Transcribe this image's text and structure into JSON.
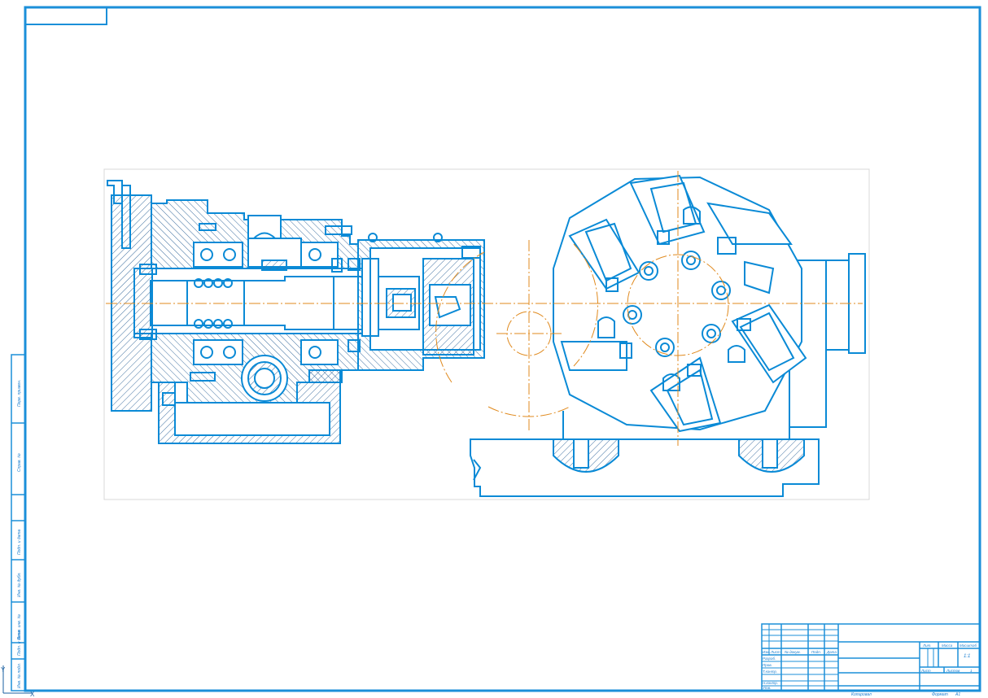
{
  "colors": {
    "line": "#0a8ad6",
    "hatch": "#3d6fa0",
    "center": "#e08a1e",
    "frame": "#1b8fd9"
  },
  "side_strip": {
    "labels": [
      "Перв. примен.",
      "Справ. №",
      "Подп. и дата",
      "Инв. № дубл.",
      "Взам. инв. №",
      "Подп. и дата",
      "Инв. № подл."
    ]
  },
  "title_block": {
    "col_heads": [
      "Изм.",
      "Лист",
      "№ докум.",
      "Подп.",
      "Дата"
    ],
    "row_labels": [
      "Разраб.",
      "Пров.",
      "Т.контр.",
      "Н.контр.",
      "Утв."
    ],
    "lit_heads": [
      "Лит.",
      "Масса",
      "Масштаб"
    ],
    "scale": "1:1",
    "sheet_label": "Лист",
    "sheets_label": "Листов",
    "sheets_value": "1",
    "copied": "Копировал",
    "format": "Формат",
    "format_value": "A1"
  },
  "icons": {
    "origin": "ucs-axis-icon"
  }
}
